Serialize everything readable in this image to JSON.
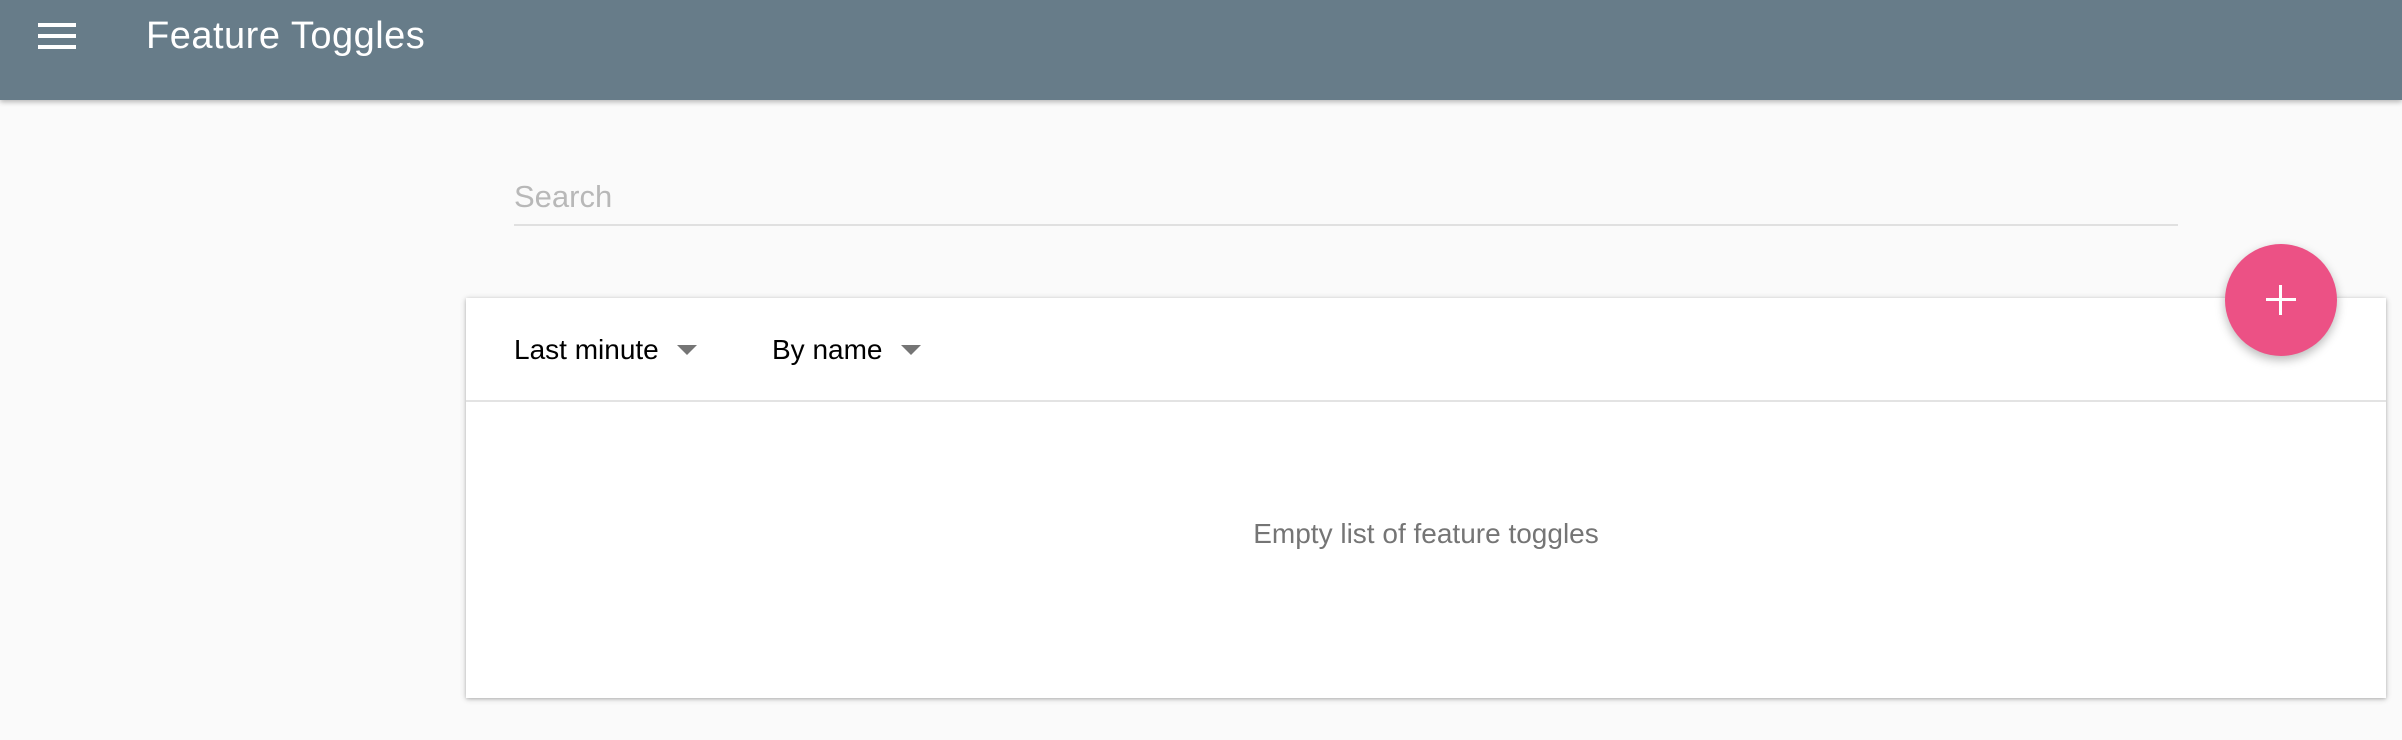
{
  "header": {
    "title": "Feature Toggles",
    "menu_icon": "menu-icon"
  },
  "search": {
    "placeholder": "Search",
    "value": ""
  },
  "filters": {
    "time_label": "Last minute",
    "sort_label": "By name"
  },
  "list": {
    "empty_message": "Empty list of feature toggles",
    "items": []
  },
  "fab": {
    "icon": "plus-icon"
  },
  "colors": {
    "app_bar": "#677c89",
    "accent": "#ec5185",
    "background": "#fafafa"
  }
}
